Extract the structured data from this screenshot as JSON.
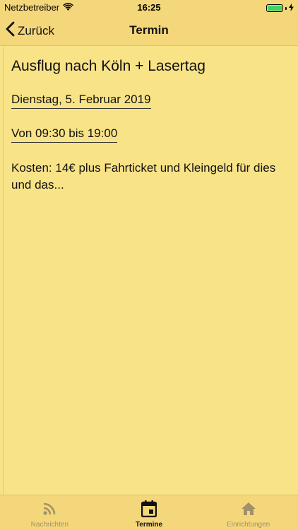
{
  "status_bar": {
    "carrier": "Netzbetreiber",
    "time": "16:25"
  },
  "nav": {
    "back_label": "Zurück",
    "title": "Termin"
  },
  "event": {
    "title": "Ausflug nach Köln + Lasertag",
    "date": "Dienstag, 5. Februar 2019",
    "time": "Von 09:30 bis 19:00",
    "description": "Kosten: 14€ plus Fahrticket und Kleingeld für dies und das..."
  },
  "tabs": [
    {
      "label": "Nachrichten",
      "icon": "rss-icon",
      "active": false
    },
    {
      "label": "Termine",
      "icon": "calendar-icon",
      "active": true
    },
    {
      "label": "Einrichtungen",
      "icon": "home-icon",
      "active": false
    }
  ],
  "colors": {
    "background": "#f9e387",
    "bars": "#f5d77b",
    "battery": "#3fd45f",
    "inactive_tab": "#a0916a"
  }
}
